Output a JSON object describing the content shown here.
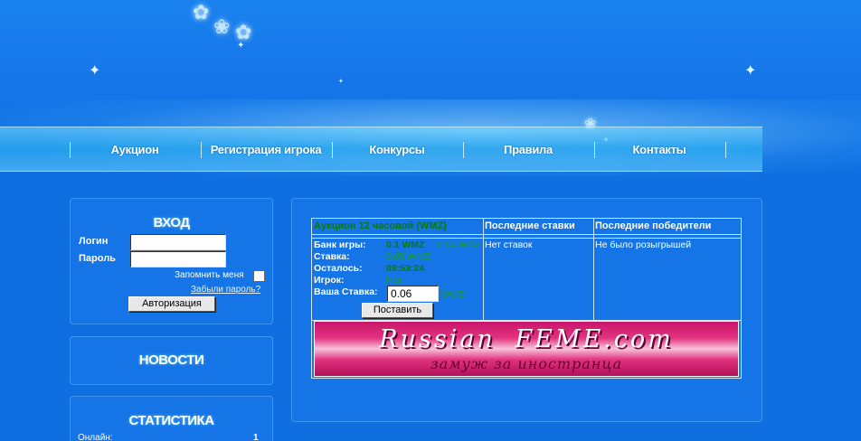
{
  "nav": {
    "items": [
      "Аукцион",
      "Регистрация игрока",
      "Конкурсы",
      "Правила",
      "Контакты"
    ]
  },
  "login": {
    "title": "ВХОД",
    "login_label": "Логин",
    "password_label": "Пароль",
    "login_value": "",
    "password_value": "",
    "remember_label": "Запомнить меня",
    "forgot_link": "Забыли пароль?",
    "submit_label": "Авторизация"
  },
  "news": {
    "title": "НОВОСТИ"
  },
  "stats": {
    "title": "СТАТИСТИКА",
    "online_label": "Онлайн:",
    "online_value": "1"
  },
  "auction": {
    "headers": {
      "auction": "Аукцион 12 часовой (WMZ)",
      "last_bids": "Последние ставки",
      "last_winners": "Последние победители"
    },
    "bank_label": "Банк игры:",
    "bank_value": "0.1 WMZ",
    "bank_extra": "0.14 WMZ",
    "bid_label": "Ставка:",
    "bid_value": "0.05 WMZ",
    "remaining_label": "Осталось:",
    "remaining_value": "09:53:24",
    "player_label": "Игрок:",
    "player_value": "Нет",
    "your_bid_label": "Ваша Ставка:",
    "your_bid_value": "0.06",
    "your_bid_unit": "WMZ",
    "submit_label": "Поставить",
    "last_bids_text": "Нет ставок",
    "last_winners_text": "Не было розыгрышей"
  },
  "banner": {
    "main": "Russian FEME.com",
    "sub": "замуж за иностранца"
  },
  "colors": {
    "background": "#0f6fe0",
    "panel": "#1574e6",
    "banner": "#e2337f",
    "green": "#0a7a0a"
  }
}
